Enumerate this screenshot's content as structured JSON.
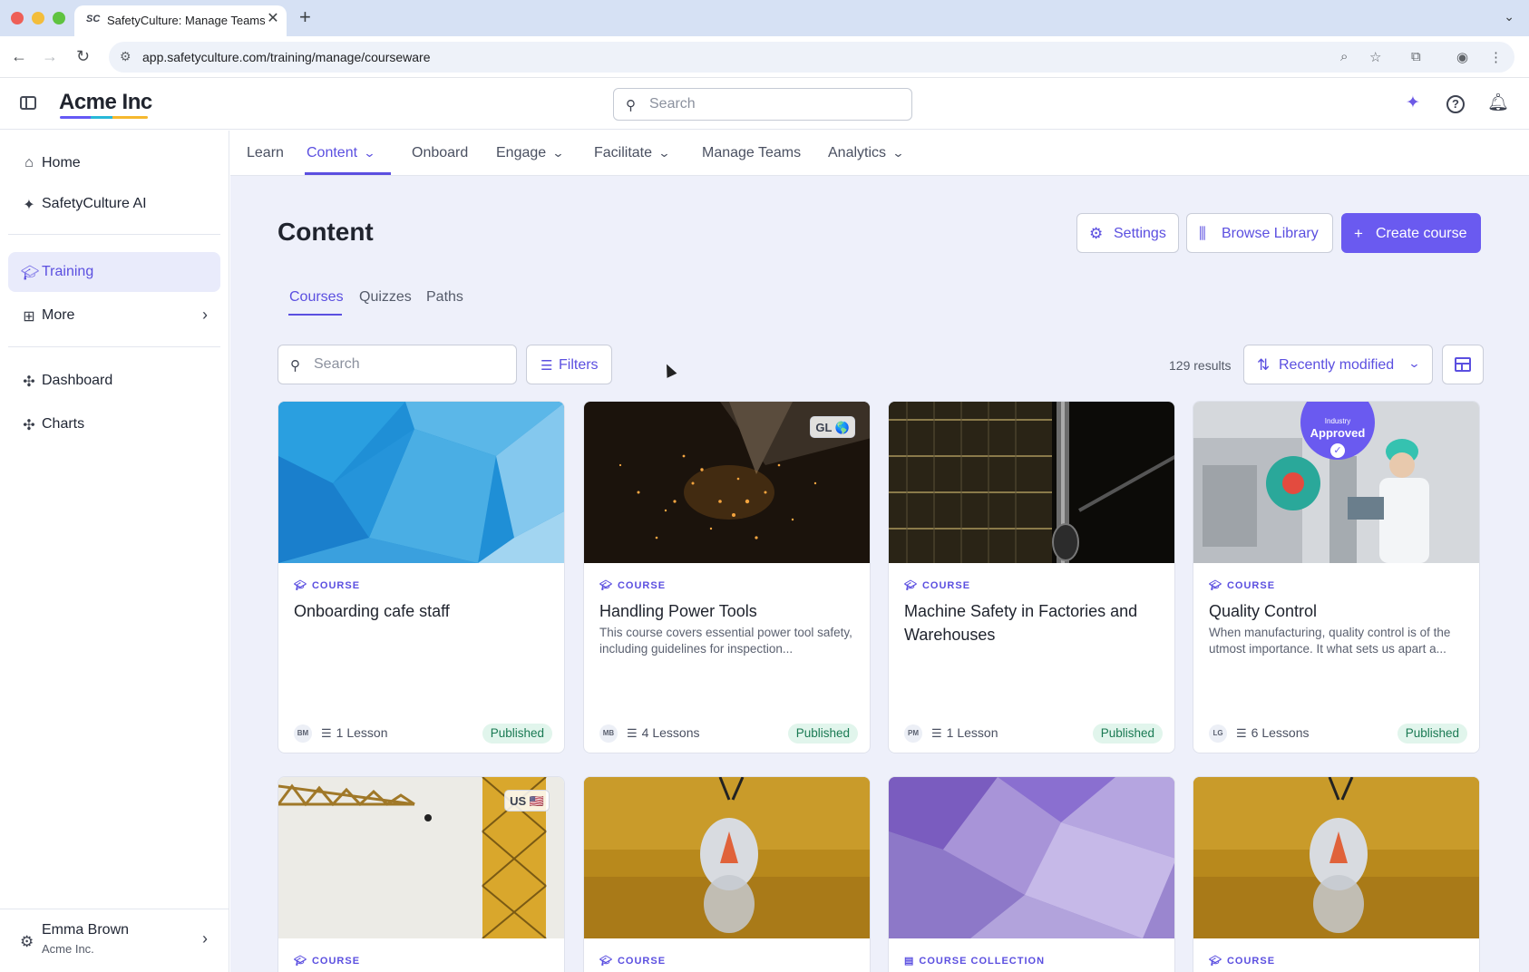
{
  "browser": {
    "tab_title": "SafetyCulture: Manage Teams",
    "favicon": "SC",
    "url": "app.safetyculture.com/training/manage/courseware"
  },
  "header": {
    "brand": "Acme Inc",
    "search_placeholder": "Search"
  },
  "sidebar": {
    "items": [
      {
        "label": "Home",
        "icon": "home-icon"
      },
      {
        "label": "SafetyCulture AI",
        "icon": "sparkle-icon"
      },
      {
        "label": "Training",
        "icon": "graduation-cap-icon",
        "active": true
      },
      {
        "label": "More",
        "icon": "grid-icon"
      },
      {
        "label": "Dashboard",
        "icon": "puzzle-icon"
      },
      {
        "label": "Charts",
        "icon": "puzzle-icon"
      }
    ],
    "profile": {
      "name": "Emma Brown",
      "org": "Acme Inc."
    }
  },
  "topnav": {
    "items": [
      {
        "label": "Learn"
      },
      {
        "label": "Content",
        "active": true,
        "dropdown": true
      },
      {
        "label": "Onboard"
      },
      {
        "label": "Engage",
        "dropdown": true
      },
      {
        "label": "Facilitate",
        "dropdown": true
      },
      {
        "label": "Manage Teams"
      },
      {
        "label": "Analytics",
        "dropdown": true
      }
    ]
  },
  "main": {
    "title": "Content",
    "buttons": {
      "settings": "Settings",
      "browse_library": "Browse Library",
      "create_course": "Create course"
    },
    "tabs": [
      {
        "label": "Courses",
        "active": true
      },
      {
        "label": "Quizzes"
      },
      {
        "label": "Paths"
      }
    ],
    "search_placeholder": "Search",
    "filters_label": "Filters",
    "results": "129 results",
    "sort_label": "Recently modified"
  },
  "cards": [
    {
      "kind": "COURSE",
      "title": "Onboarding cafe staff",
      "desc": "",
      "avatar": "BM",
      "lessons": "1 Lesson",
      "status": "Published"
    },
    {
      "kind": "COURSE",
      "title": "Handling Power Tools",
      "desc": "This course covers essential power tool safety, including guidelines for inspection...",
      "avatar": "MB",
      "lessons": "4 Lessons",
      "status": "Published",
      "badge": "GL 🌎"
    },
    {
      "kind": "COURSE",
      "title": "Machine Safety in Factories and Warehouses",
      "desc": "",
      "avatar": "PM",
      "lessons": "1 Lesson",
      "status": "Published"
    },
    {
      "kind": "COURSE",
      "title": "Quality Control",
      "desc": "When manufacturing, quality control is of the utmost importance. It what sets us apart a...",
      "avatar": "LG",
      "lessons": "6 Lessons",
      "status": "Published",
      "approved_small": "Industry",
      "approved_big": "Approved"
    },
    {
      "kind": "COURSE",
      "badge": "US 🇺🇸"
    },
    {
      "kind": "COURSE"
    },
    {
      "kind": "COURSE COLLECTION"
    },
    {
      "kind": "COURSE"
    }
  ],
  "colors": {
    "accent": "#5b4fe0",
    "primary_button": "#6a5af0",
    "published_bg": "#e1f5ec",
    "published_text": "#1a7a53",
    "main_bg": "#eef0fa"
  }
}
